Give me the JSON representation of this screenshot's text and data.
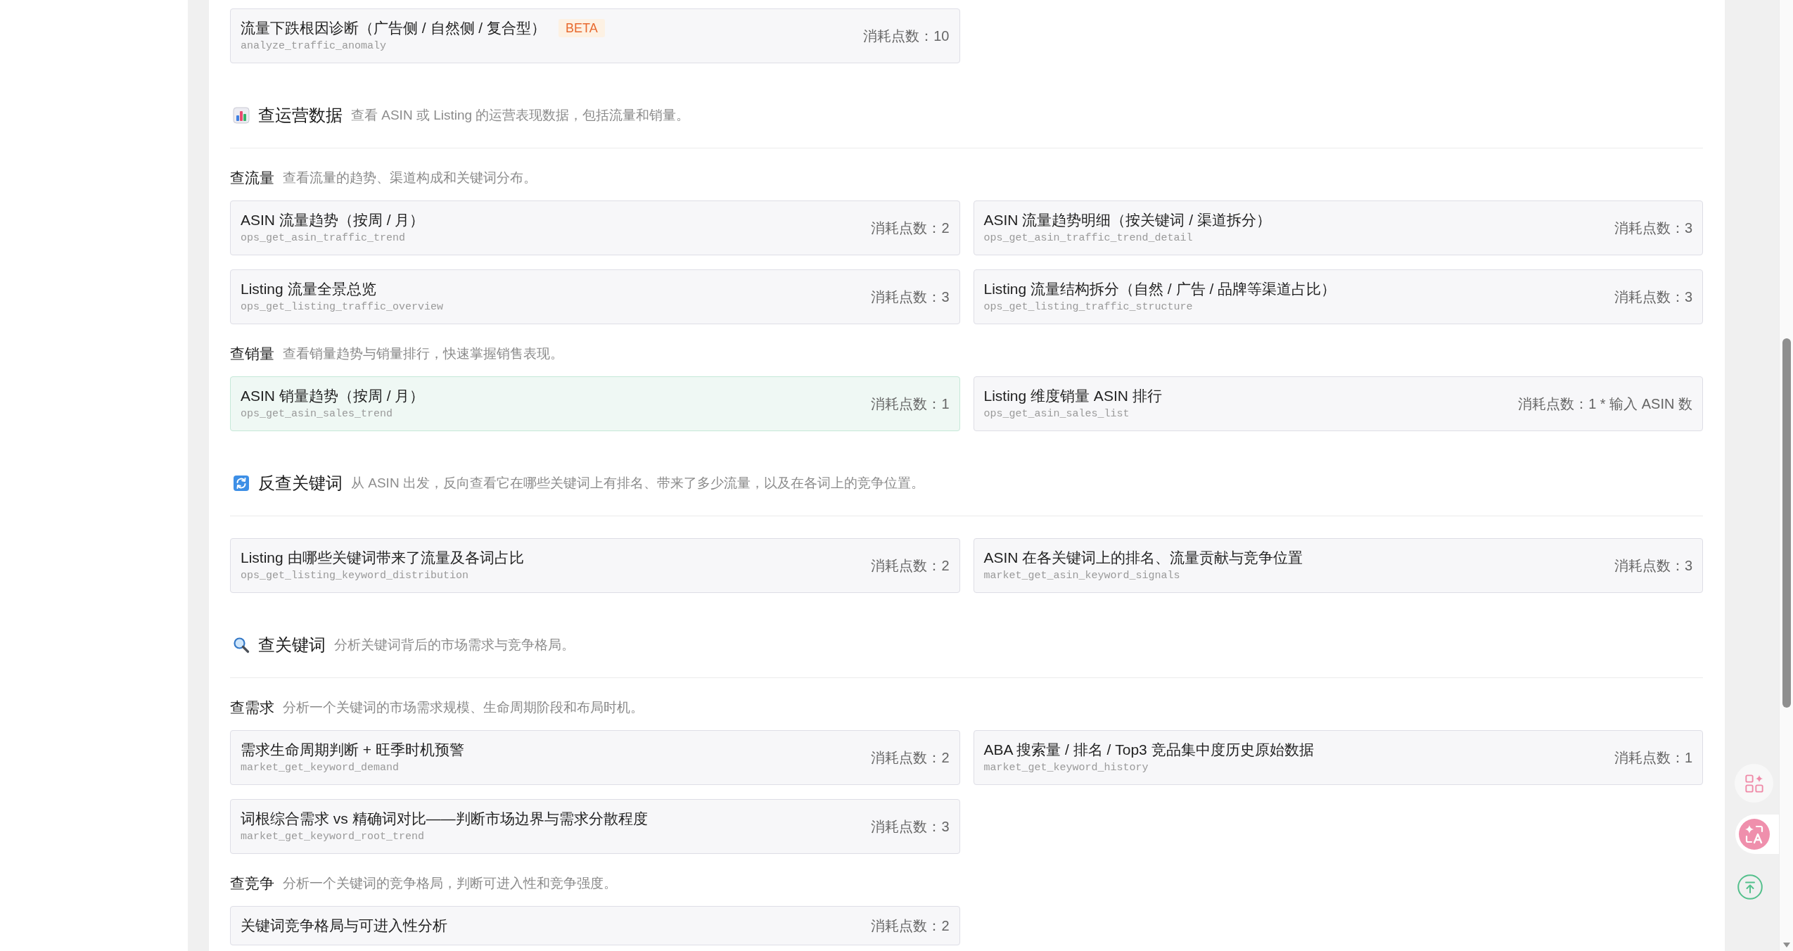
{
  "previous_section": {
    "cards": [
      {
        "title": "流量下跌根因诊断（广告侧 / 自然侧 / 复合型）",
        "badge": "BETA",
        "code": "analyze_traffic_anomaly",
        "points": "消耗点数：10",
        "highlighted": false
      }
    ]
  },
  "sections": [
    {
      "title": "查运营数据",
      "description": "查看 ASIN 或 Listing 的运营表现数据，包括流量和销量。",
      "groups": [
        {
          "label": "查流量",
          "description": "查看流量的趋势、渠道构成和关键词分布。",
          "cards": [
            {
              "title": "ASIN 流量趋势（按周 / 月）",
              "code": "ops_get_asin_traffic_trend",
              "points": "消耗点数：2",
              "highlighted": false
            },
            {
              "title": "ASIN 流量趋势明细（按关键词 / 渠道拆分）",
              "code": "ops_get_asin_traffic_trend_detail",
              "points": "消耗点数：3",
              "highlighted": false
            },
            {
              "title": "Listing 流量全景总览",
              "code": "ops_get_listing_traffic_overview",
              "points": "消耗点数：3",
              "highlighted": false
            },
            {
              "title": "Listing 流量结构拆分（自然 / 广告 / 品牌等渠道占比）",
              "code": "ops_get_listing_traffic_structure",
              "points": "消耗点数：3",
              "highlighted": false
            }
          ]
        },
        {
          "label": "查销量",
          "description": "查看销量趋势与销量排行，快速掌握销售表现。",
          "cards": [
            {
              "title": "ASIN 销量趋势（按周 / 月）",
              "code": "ops_get_asin_sales_trend",
              "points": "消耗点数：1",
              "highlighted": true
            },
            {
              "title": "Listing 维度销量 ASIN 排行",
              "code": "ops_get_asin_sales_list",
              "points": "消耗点数：1 * 输入 ASIN 数",
              "highlighted": false
            }
          ]
        }
      ]
    },
    {
      "title": "反查关键词",
      "description": "从 ASIN 出发，反向查看它在哪些关键词上有排名、带来了多少流量，以及在各词上的竞争位置。",
      "groups": [
        {
          "cards": [
            {
              "title": "Listing 由哪些关键词带来了流量及各词占比",
              "code": "ops_get_listing_keyword_distribution",
              "points": "消耗点数：2",
              "highlighted": false
            },
            {
              "title": "ASIN 在各关键词上的排名、流量贡献与竞争位置",
              "code": "market_get_asin_keyword_signals",
              "points": "消耗点数：3",
              "highlighted": false
            }
          ]
        }
      ]
    },
    {
      "title": "查关键词",
      "description": "分析关键词背后的市场需求与竞争格局。",
      "groups": [
        {
          "label": "查需求",
          "description": "分析一个关键词的市场需求规模、生命周期阶段和布局时机。",
          "cards": [
            {
              "title": "需求生命周期判断 + 旺季时机预警",
              "code": "market_get_keyword_demand",
              "points": "消耗点数：2",
              "highlighted": false
            },
            {
              "title": "ABA 搜索量 / 排名 / Top3 竞品集中度历史原始数据",
              "code": "market_get_keyword_history",
              "points": "消耗点数：1",
              "highlighted": false
            },
            {
              "title": "词根综合需求 vs 精确词对比——判断市场边界与需求分散程度",
              "code": "market_get_keyword_root_trend",
              "points": "消耗点数：3",
              "highlighted": false
            }
          ]
        },
        {
          "label": "查竞争",
          "description": "分析一个关键词的竞争格局，判断可进入性和竞争强度。",
          "cards": [
            {
              "title": "关键词竞争格局与可进入性分析",
              "points": "消耗点数：2",
              "highlighted": false
            }
          ]
        }
      ]
    }
  ]
}
